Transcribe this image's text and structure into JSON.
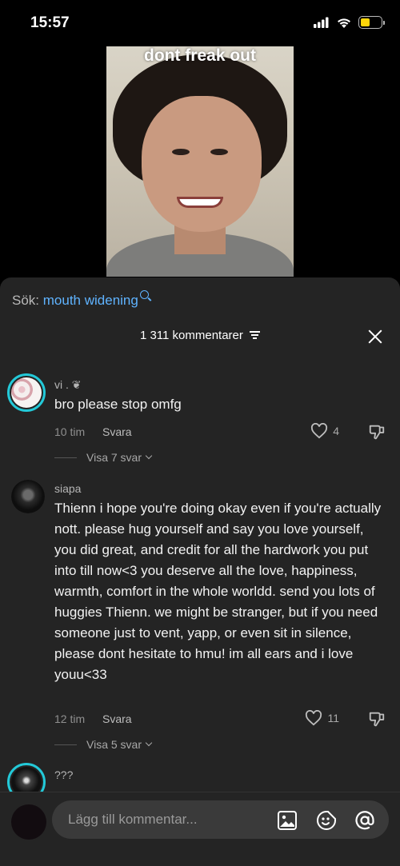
{
  "status_bar": {
    "time": "15:57",
    "battery_color": "#ffd60a"
  },
  "video": {
    "caption": "dont freak out"
  },
  "comments_panel": {
    "search_prefix": "Sök:",
    "search_term": "mouth widening",
    "comment_count": "1 311 kommentarer",
    "comments": [
      {
        "username": "vi . ❦",
        "text": "bro please stop omfg",
        "time": "10 tim",
        "reply_label": "Svara",
        "likes": "4",
        "view_replies": "Visa 7 svar"
      },
      {
        "username": "siapa",
        "text": "Thienn i hope you're doing okay even if you're actually nott. please hug yourself and say you love yourself, you did great, and credit for all the hardwork you put into till now<3 you deserve all the love, happiness, warmth, comfort in the whole worldd. send you lots of huggies Thienn. we might be stranger, but if you need someone just to vent, yapp, or even sit in silence, please dont hesitate to hmu! im all ears and i love youu<33",
        "time": "12 tim",
        "reply_label": "Svara",
        "likes": "11",
        "view_replies": "Visa 5 svar"
      },
      {
        "username": "???"
      }
    ]
  },
  "composer": {
    "placeholder": "Lägg till kommentar..."
  },
  "colors": {
    "accent": "#5fb3ff",
    "story_ring": "#23c9d8",
    "panel_bg": "#242424"
  }
}
